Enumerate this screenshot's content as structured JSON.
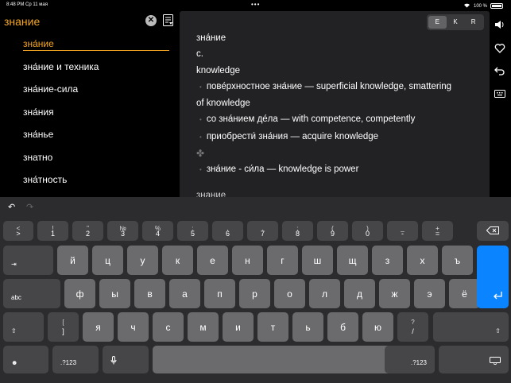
{
  "status": {
    "time": "8:48 PM",
    "date": "Ср 11 мая",
    "battery": "100 %"
  },
  "search": {
    "query": "знание"
  },
  "word_list": [
    "зна́ние",
    "зна́ние и техника",
    "зна́ние-сила",
    "зна́ния",
    "зна́нье",
    "знатно",
    "зна́тность"
  ],
  "lang_switch": [
    "E",
    "K",
    "R"
  ],
  "entry": {
    "headword": "зна́ние",
    "pos": "с.",
    "translation": "knowledge",
    "ex1a": "пове́рхностное зна́ние — superficial knowledge, smattering",
    "ex1b": "of knowledge",
    "ex2": "со зна́нием де́ла — with competence, competently",
    "ex3": "приобрести́ зна́ния — acquire knowledge",
    "club": "✤",
    "ex4": "зна́ние - си́ла — knowledge is power",
    "next": "знание"
  },
  "keys_row1": [
    {
      "top": "<",
      "bot": ">"
    },
    {
      "top": "!",
      "bot": "1"
    },
    {
      "top": "\"",
      "bot": "2"
    },
    {
      "top": "№",
      "bot": "3"
    },
    {
      "top": "%",
      "bot": "4"
    },
    {
      "top": ":",
      "bot": "5"
    },
    {
      "top": ",",
      "bot": "6"
    },
    {
      "top": ".",
      "bot": "7"
    },
    {
      "top": ";",
      "bot": "8"
    },
    {
      "top": "(",
      "bot": "9"
    },
    {
      "top": ")",
      "bot": "0"
    },
    {
      "top": "_",
      "bot": "-"
    },
    {
      "top": "+",
      "bot": "="
    }
  ],
  "keys_row2": [
    "й",
    "ц",
    "у",
    "к",
    "е",
    "н",
    "г",
    "ш",
    "щ",
    "з",
    "х",
    "ъ"
  ],
  "keys_row3": [
    "ф",
    "ы",
    "в",
    "а",
    "п",
    "р",
    "о",
    "л",
    "д",
    "ж",
    "э",
    "ё"
  ],
  "keys_row4": [
    "я",
    "ч",
    "с",
    "м",
    "и",
    "т",
    "ь",
    "б",
    "ю"
  ],
  "bracket_key": {
    "top": "[",
    "bot": "]"
  },
  "question_key": {
    "top": "?",
    "bot": "/"
  },
  "labels": {
    "tab": "⇥",
    "abc": "abc",
    "num_left": ".?123",
    "num_right": ".?123"
  }
}
